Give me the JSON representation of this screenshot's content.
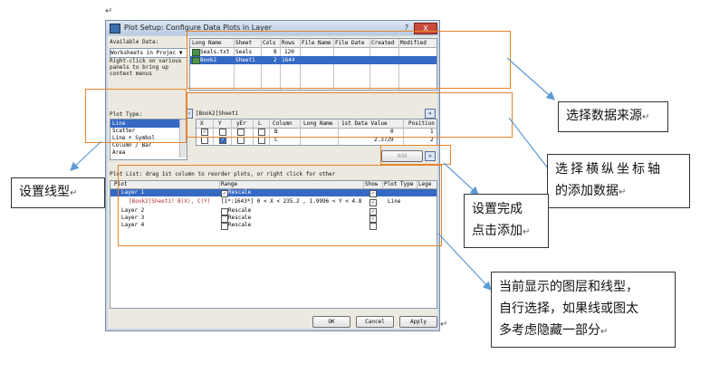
{
  "dialog": {
    "title": "Plot Setup: Configure Data Plots in Layer",
    "help": "?",
    "close": "X",
    "available_label": "Available Data:",
    "available_value": "Worksheets in Projec ▼",
    "hint": [
      "Right-click on various",
      "panels to bring up",
      "context menus"
    ],
    "plot_type_label": "Plot Type:",
    "plot_types": [
      "Line",
      "Scatter",
      "Line + Symbol",
      "Column / Bar",
      "Area"
    ],
    "source_columns": [
      "Long Name",
      "Sheet",
      "Cols",
      "Rows",
      "File Name",
      "File Date",
      "Created",
      "Modified"
    ],
    "source_rows": [
      {
        "long_name": "Seals.txt",
        "sheet": "Seals",
        "cols": "8",
        "rows": "120"
      },
      {
        "long_name": "Book2",
        "sheet": "Sheet1",
        "cols": "2",
        "rows": "1644"
      }
    ],
    "sheet_path": "[Book2]Sheet1",
    "xy_columns": [
      "X",
      "Y",
      "yEr",
      "L",
      "Column",
      "Long Name",
      "1st Data Value",
      "Position"
    ],
    "xy_rows": [
      {
        "column": "B",
        "first": "0",
        "pos": "1"
      },
      {
        "column": "C",
        "first": "2.3729",
        "pos": "2"
      }
    ],
    "add_label": "Add",
    "plot_list_label": "Plot List: drag 1st column to reorder plots, or right click for other",
    "plot_list_columns": [
      "Plot",
      "Range",
      "Show",
      "Plot Type",
      "Lege"
    ],
    "plot_list_rows": [
      {
        "plot": "Layer 1",
        "range": "Rescale",
        "check": "✓",
        "type": ""
      },
      {
        "plot": "[Book2]Sheet1! B(X), C(Y)",
        "range": "[1*:1643*]   0 < X < 235.2 , 1.9996 < Y < 4.8",
        "check": "✓",
        "type": "Line"
      },
      {
        "plot": "Layer 2",
        "range": "Rescale",
        "check": "✓",
        "type": ""
      },
      {
        "plot": "Layer 3",
        "range": "Rescale",
        "check": "✓",
        "type": ""
      },
      {
        "plot": "Layer 4",
        "range": "Rescale",
        "check": "",
        "type": ""
      }
    ],
    "ok": "OK",
    "cancel": "Cancel",
    "apply": "Apply"
  },
  "callouts": {
    "data_source": "选择数据来源",
    "xy_axis": [
      "选择横纵坐标轴",
      "的添加数据"
    ],
    "line_type": "设置线型",
    "add_done": [
      "设置完成",
      "点击添加"
    ],
    "current": [
      "当前显示的图层和线型，",
      "自行选择，如果线或图太",
      "多考虑隐藏一部分"
    ]
  },
  "marks": {
    "para": "↵"
  },
  "colors": {
    "orange": "#e7842b",
    "arrow": "#5b9bd5",
    "selection": "#3569c4"
  }
}
